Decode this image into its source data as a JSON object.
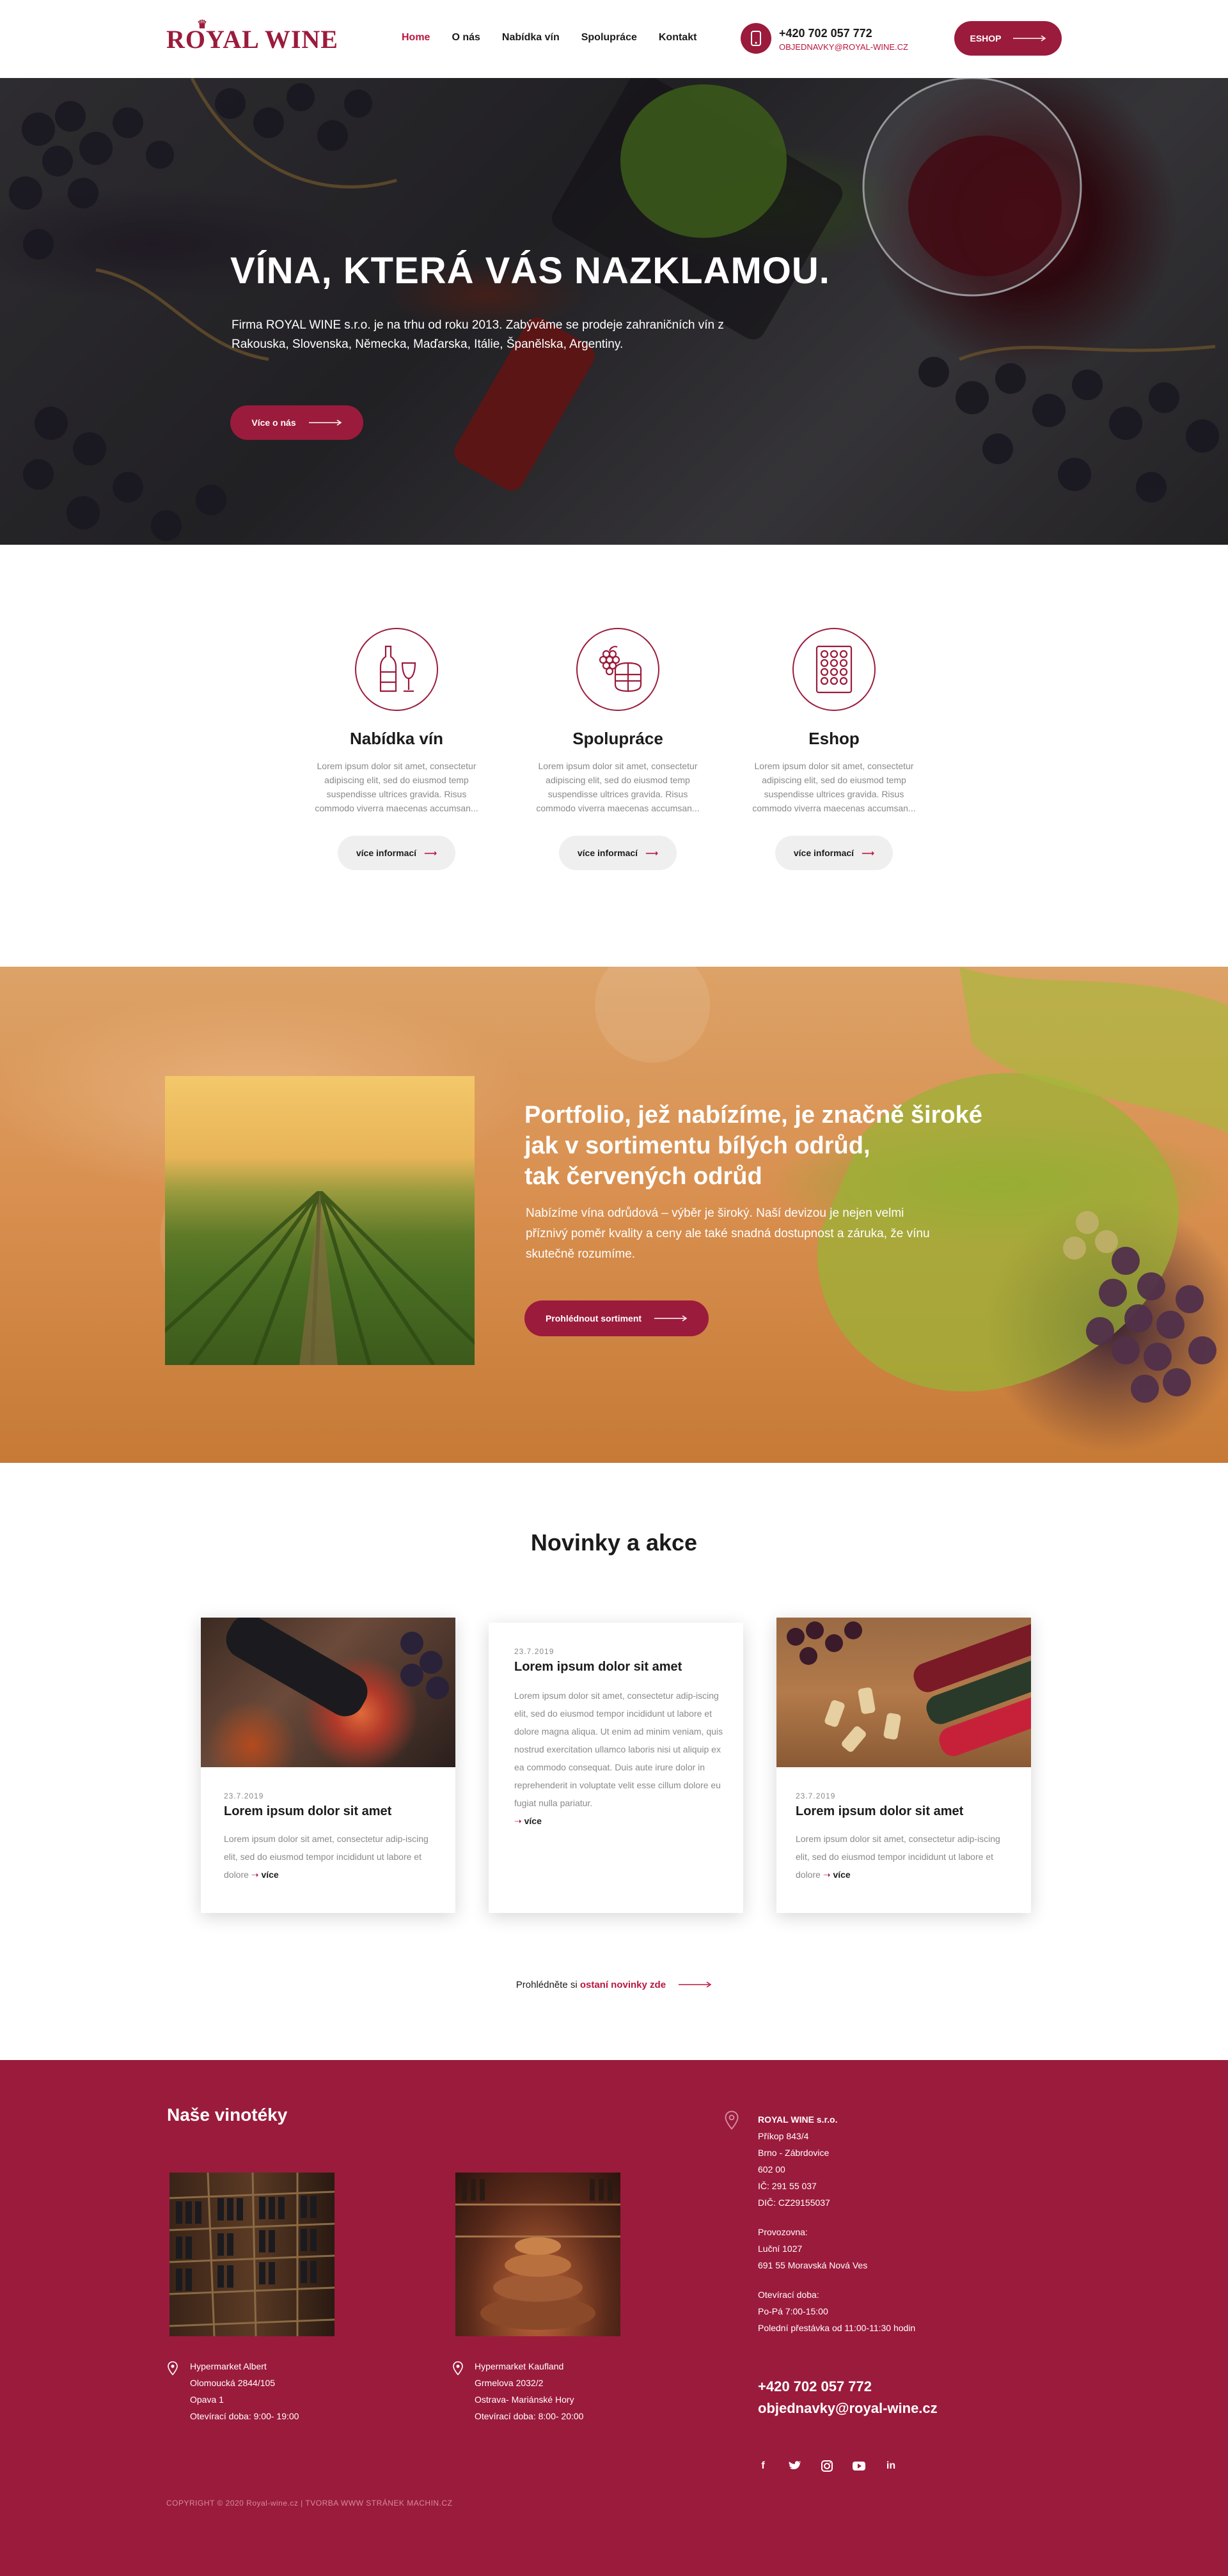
{
  "header": {
    "logo": "ROYAL WINE",
    "nav": [
      "Home",
      "O nás",
      "Nabídka vín",
      "Spolupráce",
      "Kontakt"
    ],
    "phone": "+420 702 057 772",
    "email": "OBJEDNAVKY@ROYAL-WINE.CZ",
    "eshop_label": "ESHOP"
  },
  "hero": {
    "title": "VÍNA, KTERÁ VÁS NAZKLAMOU.",
    "text": "Firma ROYAL WINE s.r.o. je na trhu od roku 2013. Zabýváme se prodeje zahraničních vín z Rakouska, Slovenska, Německa, Maďarska, Itálie, Španělska, Argentiny.",
    "button": "Více o nás"
  },
  "services": [
    {
      "title": "Nabídka vín",
      "icon": "wine-bottle-glass-icon",
      "text": "Lorem ipsum dolor sit amet, consectetur adipiscing elit, sed do eiusmod temp suspendisse ultrices gravida. Risus commodo viverra maecenas accumsan...",
      "button": "více informací"
    },
    {
      "title": "Spolupráce",
      "icon": "grapes-barrel-icon",
      "text": "Lorem ipsum dolor sit amet, consectetur adipiscing elit, sed do eiusmod temp suspendisse ultrices gravida. Risus commodo viverra maecenas accumsan...",
      "button": "více informací"
    },
    {
      "title": "Eshop",
      "icon": "wine-rack-icon",
      "text": "Lorem ipsum dolor sit amet, consectetur adipiscing elit, sed do eiusmod temp suspendisse ultrices gravida. Risus commodo viverra maecenas accumsan...",
      "button": "více informací"
    }
  ],
  "portfolio": {
    "title_line1": "Portfolio, jež nabízíme, je značně široké",
    "title_line2": "jak v sortimentu bílých odrůd,",
    "title_line3": "tak červených odrůd",
    "text": "Nabízíme vína odrůdová – výběr je široký. Naší devizou je nejen velmi příznivý poměr kvality a ceny ale také snadná dostupnost a záruka, že vínu skutečně rozumíme.",
    "button": "Prohlédnout sortiment"
  },
  "news": {
    "heading": "Novinky a akce",
    "cards": [
      {
        "date": "23.7.2019",
        "title": "Lorem ipsum dolor sit amet",
        "text": "Lorem ipsum dolor sit amet, consectetur adip-iscing elit, sed do eiusmod tempor incididunt ut labore et dolore",
        "more": "více"
      },
      {
        "date": "23.7.2019",
        "title": "Lorem ipsum dolor sit amet",
        "text": "Lorem ipsum dolor sit amet, consectetur adip-iscing elit, sed do eiusmod tempor incididunt ut labore et dolore magna aliqua. Ut enim ad minim veniam, quis nostrud exercitation ullamco laboris nisi ut aliquip ex ea commodo consequat. Duis aute irure dolor in reprehenderit in voluptate velit esse cillum dolore eu fugiat nulla pariatur.",
        "more": "více"
      },
      {
        "date": "23.7.2019",
        "title": "Lorem ipsum dolor sit amet",
        "text": "Lorem ipsum dolor sit amet, consectetur adip-iscing elit, sed do eiusmod tempor incididunt ut labore et dolore",
        "more": "více"
      }
    ],
    "more_prefix": "Prohlédněte si",
    "more_link": "ostaní novinky zde"
  },
  "footer": {
    "heading": "Naše vinotéky",
    "shops": [
      {
        "line1": "Hypermarket Albert",
        "line2": "Olomoucká 2844/105",
        "line3": "Opava 1",
        "line4": "Otevírací doba: 9:00- 19:00"
      },
      {
        "line1": "Hypermarket Kaufland",
        "line2": "Grmelova 2032/2",
        "line3": "Ostrava- Mariánské Hory",
        "line4": "Otevírací doba: 8:00- 20:00"
      }
    ],
    "company": {
      "name": "ROYAL WINE s.r.o.",
      "street": "Příkop 843/4",
      "city": "Brno - Zábrdovice",
      "zip": "602 00",
      "ic": "IČ: 291 55 037",
      "dic": "DIČ: CZ29155037",
      "branch_label": "Provozovna:",
      "branch_street": "Luční 1027",
      "branch_city": "691 55 Moravská Nová Ves",
      "hours_label": "Otevírací doba:",
      "hours": "Po-Pá 7:00-15:00",
      "lunch": "Polední přestávka od 11:00-11:30 hodin"
    },
    "phone": "+420 702 057 772",
    "email": "objednavky@royal-wine.cz",
    "copyright": "COPYRIGHT © 2020 Royal-wine.cz  |  TVORBA WWW STRÁNEK MACHIN.CZ"
  }
}
